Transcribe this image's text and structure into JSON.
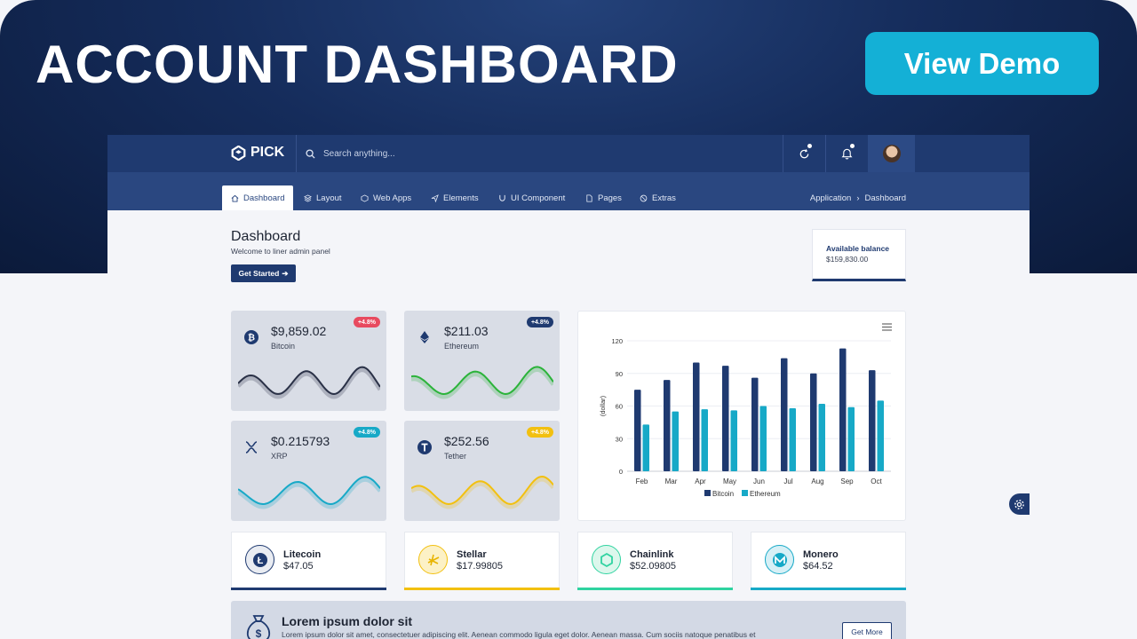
{
  "banner": {
    "title": "ACCOUNT DASHBOARD",
    "demo_label": "View Demo"
  },
  "topbar": {
    "brand": "PICK",
    "search_placeholder": "Search anything..."
  },
  "nav": {
    "items": [
      {
        "label": "Dashboard",
        "icon": "home-icon"
      },
      {
        "label": "Layout",
        "icon": "layout-icon"
      },
      {
        "label": "Web Apps",
        "icon": "apps-icon"
      },
      {
        "label": "Elements",
        "icon": "send-icon"
      },
      {
        "label": "UI Component",
        "icon": "magnet-icon"
      },
      {
        "label": "Pages",
        "icon": "page-icon"
      },
      {
        "label": "Extras",
        "icon": "extras-icon"
      }
    ],
    "breadcrumb": [
      "Application",
      "Dashboard"
    ]
  },
  "page": {
    "title": "Dashboard",
    "subtitle": "Welcome to liner admin panel",
    "cta": "Get Started"
  },
  "balance": {
    "label": "Available balance",
    "value": "$159,830.00"
  },
  "coins": [
    {
      "price": "$9,859.02",
      "name": "Bitcoin",
      "change": "+4.8%",
      "badge_color": "#e84a5f",
      "line_color": "#2a3147"
    },
    {
      "price": "$211.03",
      "name": "Ethereum",
      "change": "+4.8%",
      "badge_color": "#1f3a70",
      "line_color": "#2bb33a"
    },
    {
      "price": "$0.215793",
      "name": "XRP",
      "change": "+4.8%",
      "badge_color": "#17a9c7",
      "line_color": "#17a9c7"
    },
    {
      "price": "$252.56",
      "name": "Tether",
      "change": "+4.8%",
      "badge_color": "#f2c010",
      "line_color": "#f2c010"
    }
  ],
  "chart_data": {
    "type": "bar",
    "categories": [
      "Feb",
      "Mar",
      "Apr",
      "May",
      "Jun",
      "Jul",
      "Aug",
      "Sep",
      "Oct"
    ],
    "series": [
      {
        "name": "Bitcoin",
        "color": "#1f3a70",
        "values": [
          75,
          84,
          100,
          97,
          86,
          104,
          90,
          113,
          93
        ]
      },
      {
        "name": "Ethereum",
        "color": "#17a9c7",
        "values": [
          43,
          55,
          57,
          56,
          60,
          58,
          62,
          59,
          65
        ]
      }
    ],
    "ylabel": "(dollar)",
    "ylim": [
      0,
      120
    ],
    "yticks": [
      "0",
      "30",
      "60",
      "90",
      "120"
    ],
    "legend_position": "bottom"
  },
  "assets": [
    {
      "name": "Litecoin",
      "value": "$47.05",
      "color": "#1f3a70",
      "icon": "litecoin-icon"
    },
    {
      "name": "Stellar",
      "value": "$17.99805",
      "color": "#f2c010",
      "icon": "stellar-icon"
    },
    {
      "name": "Chainlink",
      "value": "$52.09805",
      "color": "#2fd3a0",
      "icon": "chainlink-icon"
    },
    {
      "name": "Monero",
      "value": "$64.52",
      "color": "#17a9c7",
      "icon": "monero-icon"
    }
  ],
  "promo": {
    "title": "Lorem ipsum dolor sit",
    "text": "Lorem ipsum dolor sit amet, consectetuer adipiscing elit. Aenean commodo ligula eget dolor. Aenean massa. Cum sociis natoque penatibus et",
    "button": "Get More"
  }
}
